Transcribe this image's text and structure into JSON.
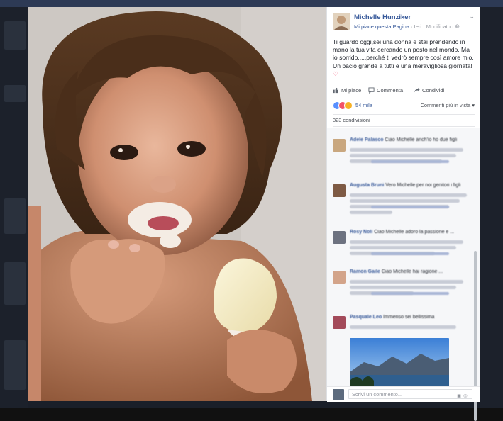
{
  "post": {
    "page_name": "Michelle Hunziker",
    "like_page": "Mi piace questa Pagina",
    "meta_rest": " · Ieri · Modificato · ",
    "globe_icon": "globe-icon",
    "text": "Ti guardo oggi,sei una donna e stai prendendo in mano la tua vita cercando un posto nel mondo. Ma io sorrido.....perché ti vedrò sempre così amore mio. Un bacio grande a tutti e una meravigliosa giornata!",
    "heart": "♡"
  },
  "actions": {
    "like": "Mi piace",
    "comment": "Commenta",
    "share": "Condividi"
  },
  "reactions": {
    "count": "54 mila",
    "view_label": "Commenti più in vista",
    "colors": [
      "#5890ff",
      "#f25268",
      "#f7b125"
    ]
  },
  "shares": {
    "label": "323 condivisioni"
  },
  "comments": [
    {
      "author": "Adele Palasco",
      "text": "Ciao Michelle anch'io ho due figli"
    },
    {
      "author": "Augusta Bruni",
      "text": "Vero Michelle per noi genitori i figli"
    },
    {
      "author": "Rosy Noli",
      "text": "Ciao Michelle adoro la passione e ..."
    },
    {
      "author": "Ramon Gaile",
      "text": "Ciao Michelle hai ragione ..."
    },
    {
      "author": "Pasquale Leo",
      "text": "Immenso sei bellissima"
    }
  ],
  "reply": {
    "placeholder": "Scrivi un commento..."
  },
  "icons": {
    "like": "thumbs-up-icon",
    "comment": "comment-bubble-icon",
    "share": "share-arrow-icon",
    "camera": "camera-icon",
    "emoji": "emoji-icon",
    "options": "chevron-down-icon"
  }
}
